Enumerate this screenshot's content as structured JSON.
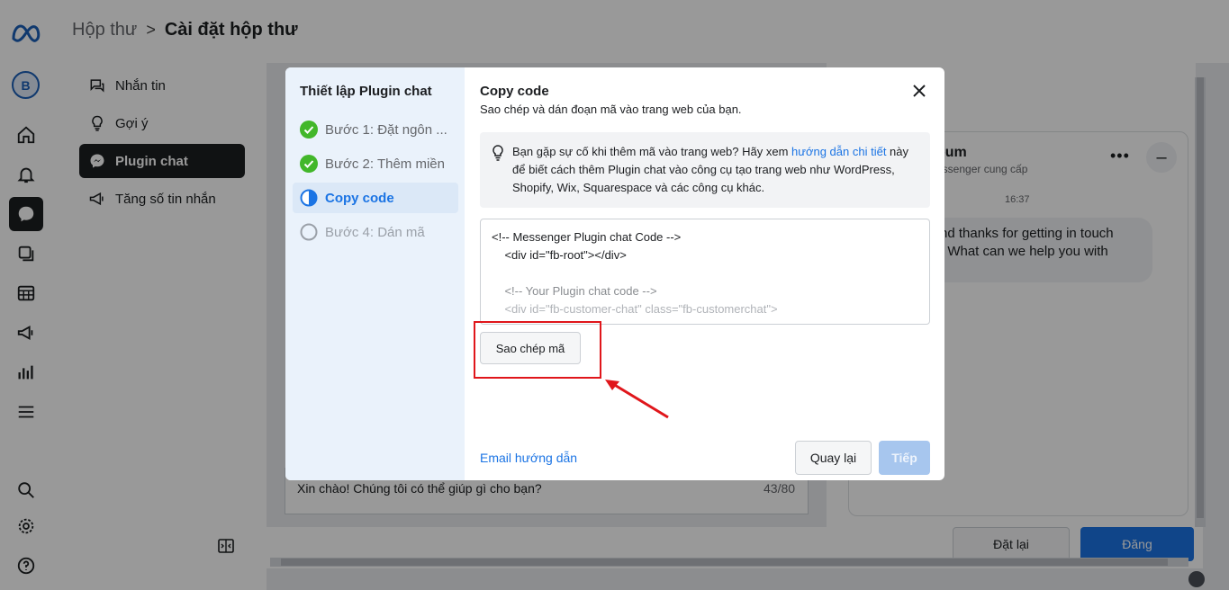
{
  "header": {
    "breadcrumb_parent": "Hộp thư",
    "breadcrumb_separator": ">",
    "breadcrumb_current": "Cài đặt hộp thư"
  },
  "rail": {
    "avatar_initial": "B",
    "icons": [
      "meta-logo-icon",
      "home-icon",
      "bell-icon",
      "inbox-chat-icon",
      "content-icon",
      "planner-grid-icon",
      "megaphone-icon",
      "insights-bar-icon",
      "menu-icon",
      "search-icon",
      "settings-gear-icon",
      "help-icon"
    ]
  },
  "settings_nav": {
    "items": [
      {
        "label": "Nhắn tin",
        "icon": "chat-bubble-icon"
      },
      {
        "label": "Gợi ý",
        "icon": "lightbulb-icon"
      },
      {
        "label": "Plugin chat",
        "icon": "messenger-icon",
        "active": true
      },
      {
        "label": "Tăng số tin nhắn",
        "icon": "megaphone-icon"
      }
    ]
  },
  "behind": {
    "greeting_text": "Xin chào! Chúng tôi có thể giúp gì cho bạn?",
    "char_counter": "43/80",
    "preview_title": "oum",
    "preview_subtitle": "essenger cung cấp",
    "preview_more": "•••",
    "preview_minimize": "–",
    "preview_time": "16:37",
    "preview_message": "nd thanks for getting in touch\n! What can we help you with",
    "reset_button": "Đặt lại",
    "post_button": "Đăng"
  },
  "modal": {
    "steps_title": "Thiết lập Plugin chat",
    "steps": [
      {
        "label": "Bước 1: Đặt ngôn ...",
        "state": "done"
      },
      {
        "label": "Bước 2: Thêm miền",
        "state": "done"
      },
      {
        "label": "Copy code",
        "state": "current"
      },
      {
        "label": "Bước 4: Dán mã",
        "state": "pending"
      }
    ],
    "title": "Copy code",
    "subtitle": "Sao chép và dán đoạn mã vào trang web của bạn.",
    "tip": {
      "text_before": "Bạn gặp sự cố khi thêm mã vào trang web? Hãy xem ",
      "link_text": "hướng dẫn chi tiết",
      "text_after": " này để biết cách thêm Plugin chat vào công cụ tạo trang web như WordPress, Shopify, Wix, Squarespace và các công cụ khác."
    },
    "code_lines": [
      "<!-- Messenger Plugin chat Code -->",
      "    <div id=\"fb-root\"></div>",
      "",
      "    <!-- Your Plugin chat code -->",
      "    <div id=\"fb-customer-chat\" class=\"fb-customerchat\">"
    ],
    "copy_button": "Sao chép mã",
    "email_link": "Email hướng dẫn",
    "back_button": "Quay lại",
    "next_button": "Tiếp"
  },
  "colors": {
    "accent": "#1b74e4",
    "highlight_annotation": "#e0161b",
    "done_check": "#42b72a"
  }
}
